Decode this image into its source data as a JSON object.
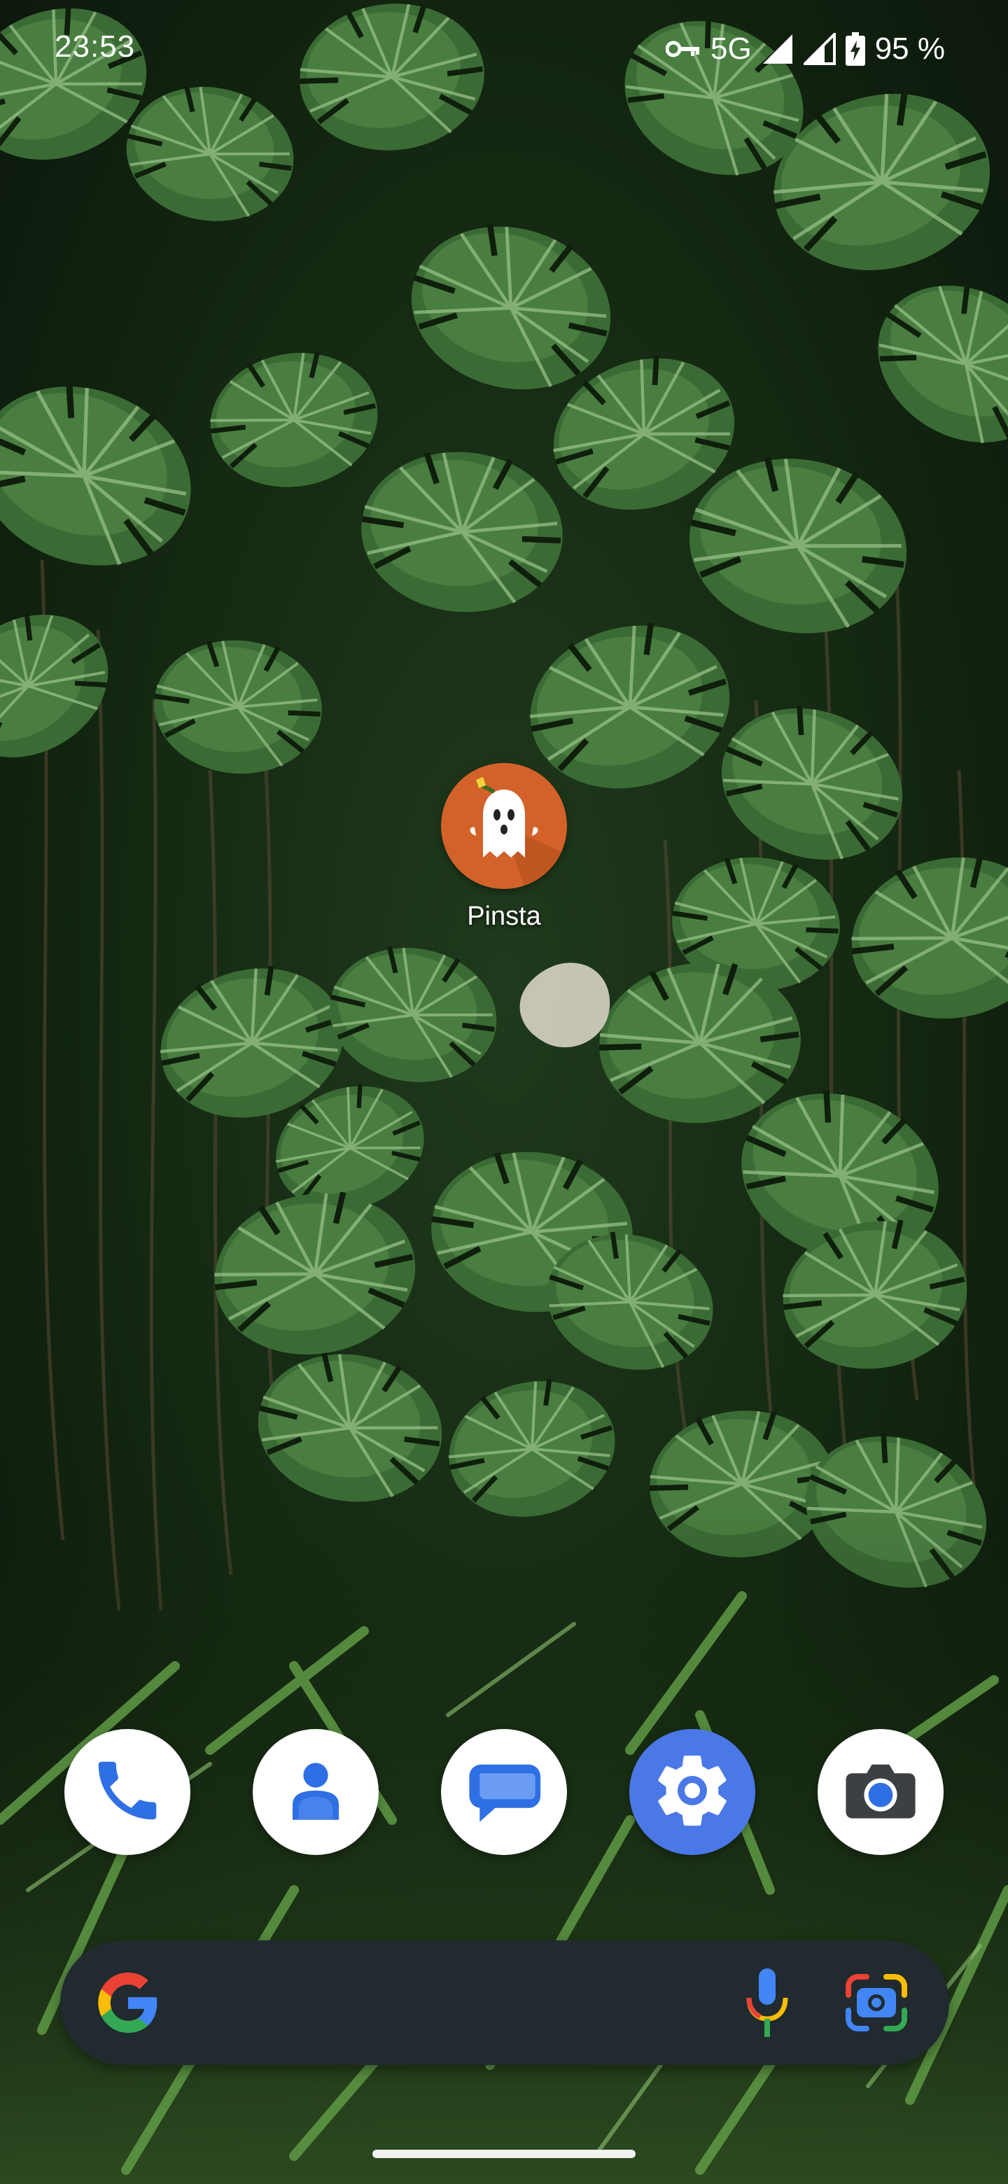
{
  "status_bar": {
    "time": "23:53",
    "network": "5G",
    "battery": "95 %",
    "icons": [
      "vpn-key-icon",
      "signal-icon",
      "signal-icon",
      "battery-charging-icon"
    ]
  },
  "home": {
    "apps": [
      {
        "label": "Pinsta",
        "icon": "ghost-icon",
        "color": "#d3622a"
      }
    ]
  },
  "dock": {
    "items": [
      {
        "name": "phone",
        "icon": "phone-icon"
      },
      {
        "name": "contacts",
        "icon": "contacts-icon"
      },
      {
        "name": "messages",
        "icon": "messages-icon"
      },
      {
        "name": "settings",
        "icon": "gear-icon"
      },
      {
        "name": "camera",
        "icon": "camera-icon"
      }
    ]
  },
  "search_bar": {
    "icons": [
      "google-g-icon",
      "microphone-icon",
      "google-lens-icon"
    ]
  },
  "colors": {
    "settings_blue": "#4a78e6",
    "google_blue": "#4285f4",
    "google_red": "#ea4335",
    "google_yellow": "#fbbc05",
    "google_green": "#34a853",
    "search_bar_bg": "#202a2f"
  }
}
